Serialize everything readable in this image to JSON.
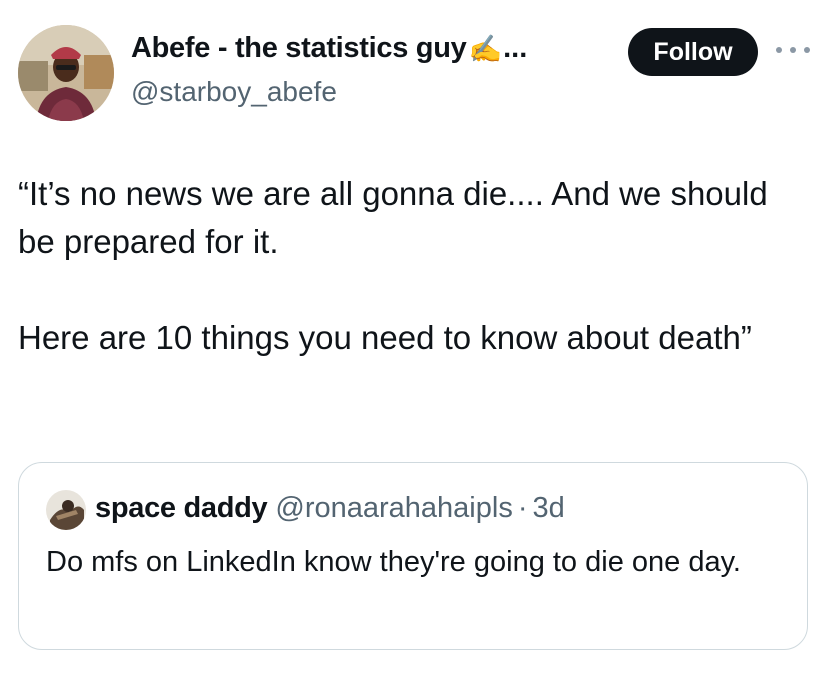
{
  "author": {
    "display_name": "Abefe - the statistics guy",
    "name_emoji": "✍️",
    "name_truncation": "...",
    "handle": "@starboy_abefe",
    "avatar_icon": "profile-photo-icon"
  },
  "actions": {
    "follow_label": "Follow",
    "more_icon": "more-options-icon"
  },
  "tweet": {
    "paragraphs": [
      "“It’s no news we are all gonna die.... And we should be prepared for it.",
      "Here are 10 things you need to know about death”"
    ]
  },
  "quoted_tweet": {
    "display_name": "space daddy",
    "handle": "@ronaarahahaipls",
    "separator": "·",
    "time": "3d",
    "text": "Do mfs on LinkedIn know they're going to die one day.",
    "avatar_icon": "profile-photo-icon"
  },
  "colors": {
    "text_primary": "#0f1419",
    "text_secondary": "#536471",
    "follow_bg": "#0f1419",
    "follow_text": "#ffffff",
    "card_border": "#cfd9de"
  }
}
